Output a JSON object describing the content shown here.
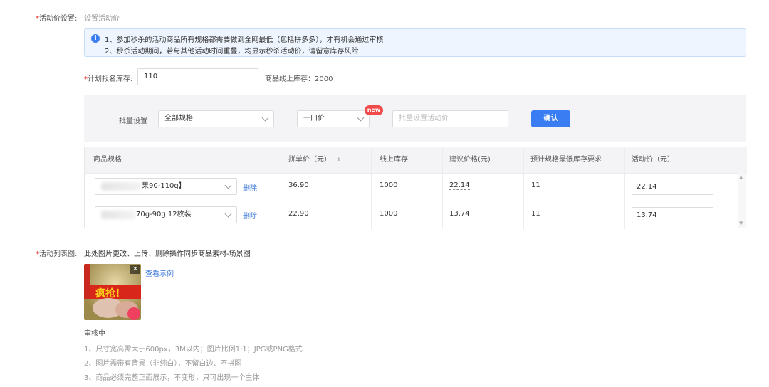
{
  "activity_price": {
    "label": "活动价设置:",
    "hint": "设置活动价",
    "notice_line1": "1、参加秒杀的活动商品所有规格都需要做到全网最低（包括拼多多），才有机会通过审核",
    "notice_line2": "2、秒杀活动期间，若与其他活动时间重叠，均显示秒杀活动价，请留意库存风险"
  },
  "stock": {
    "label": "计划报名库存:",
    "value": "110",
    "online_stock": "商品线上库存：2000"
  },
  "batch": {
    "label": "批量设置",
    "spec_select": "全部规格",
    "price_type_select": "一口价",
    "new_badge": "new",
    "price_placeholder": "批量设置活动价",
    "confirm": "确认"
  },
  "table": {
    "headers": [
      "商品规格",
      "拼单价（元）",
      "线上库存",
      "建议价格(元)",
      "预计规格最低库存要求",
      "活动价（元）"
    ],
    "rows": [
      {
        "spec": "果90-110g】",
        "delete": "删除",
        "group_price": "36.90",
        "online_stock": "1000",
        "suggest_price": "22.14",
        "min_stock": "11",
        "activity_price": "22.14"
      },
      {
        "spec": "70g-90g 12枚装",
        "delete": "删除",
        "group_price": "22.90",
        "online_stock": "1000",
        "suggest_price": "13.74",
        "min_stock": "11",
        "activity_price": "13.74"
      }
    ]
  },
  "list_image": {
    "label": "活动列表图:",
    "desc": "此处图片更改、上传、删除操作同步商品素材-场景图",
    "example_link": "查看示例",
    "thumb_text": "疯抢！",
    "status": "审核中",
    "rules": [
      "1、尺寸宽高需大于600px，3M以内；图片比例1:1；JPG或PNG格式",
      "2、图片需带有背景（非纯白），不留白边、不拼图",
      "3、商品必须完整正面展示，不变形，只可出现一个主体"
    ]
  },
  "colors": {
    "primary": "#3a7df2",
    "required": "#e02020",
    "link": "#2f6fd6",
    "notice_bg": "#eef5ff"
  }
}
